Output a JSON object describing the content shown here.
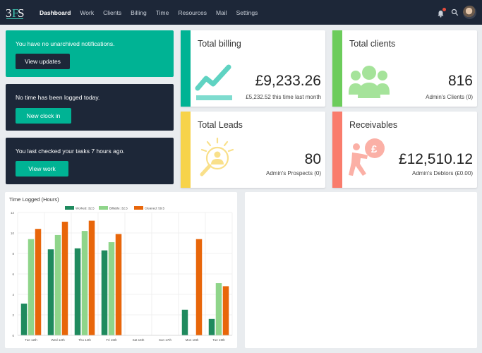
{
  "nav": {
    "items": [
      {
        "label": "Dashboard",
        "active": true
      },
      {
        "label": "Work",
        "active": false
      },
      {
        "label": "Clients",
        "active": false
      },
      {
        "label": "Billing",
        "active": false
      },
      {
        "label": "Time",
        "active": false
      },
      {
        "label": "Resources",
        "active": false
      },
      {
        "label": "Mail",
        "active": false
      },
      {
        "label": "Settings",
        "active": false
      }
    ]
  },
  "left_cards": {
    "notifications": {
      "message": "You have no unarchived notifications.",
      "button": "View updates"
    },
    "time": {
      "message": "No time has been logged today.",
      "button": "New clock in"
    },
    "tasks": {
      "message": "You last checked your tasks 7 hours ago.",
      "button": "View work"
    }
  },
  "stats": {
    "billing": {
      "title": "Total billing",
      "value": "£9,233.26",
      "sub": "£5,232.52 this time last month",
      "color": "#00b394"
    },
    "clients": {
      "title": "Total clients",
      "value": "816",
      "sub": "Admin's Clients (0)",
      "color": "#6ccc5b"
    },
    "leads": {
      "title": "Total Leads",
      "value": "80",
      "sub": "Admin's Prospects (0)",
      "color": "#f7d34a"
    },
    "receivables": {
      "title": "Receivables",
      "value": "£12,510.12",
      "sub": "Admin's Debtors (£0.00)",
      "color": "#f97c6c"
    }
  },
  "colors": {
    "nav_bg": "#1d2738",
    "green_card": "#00b394",
    "dark_card": "#1d2738",
    "button_teal": "#00b394",
    "button_dark": "#1d2738"
  },
  "chart_data": {
    "type": "bar",
    "title": "Time Logged (Hours)",
    "categories": [
      "Tue 12th",
      "Wed 12th",
      "Thu 14th",
      "Fri 15th",
      "Sat 16th",
      "Sun 17th",
      "Mon 18th",
      "Tue 19th"
    ],
    "series": [
      {
        "name": "Worked: 32.5",
        "color": "#1f8a5e",
        "values": [
          3.1,
          8.4,
          8.5,
          8.3,
          0,
          0,
          2.5,
          1.6
        ]
      },
      {
        "name": "Billable: 32.5",
        "color": "#8fd58a",
        "values": [
          9.4,
          9.8,
          10.2,
          9.1,
          0,
          0,
          0,
          5.1
        ]
      },
      {
        "name": "Cleaned: 59.5",
        "color": "#e8660a",
        "values": [
          10.4,
          11.1,
          11.2,
          9.9,
          0,
          0,
          9.4,
          4.8
        ]
      }
    ],
    "yticks": [
      "0",
      "2",
      "4",
      "6",
      "8",
      "10",
      "12"
    ],
    "ylim": [
      0,
      12
    ],
    "xlabel": "",
    "ylabel": "",
    "grid": true,
    "legend": "top-center"
  }
}
